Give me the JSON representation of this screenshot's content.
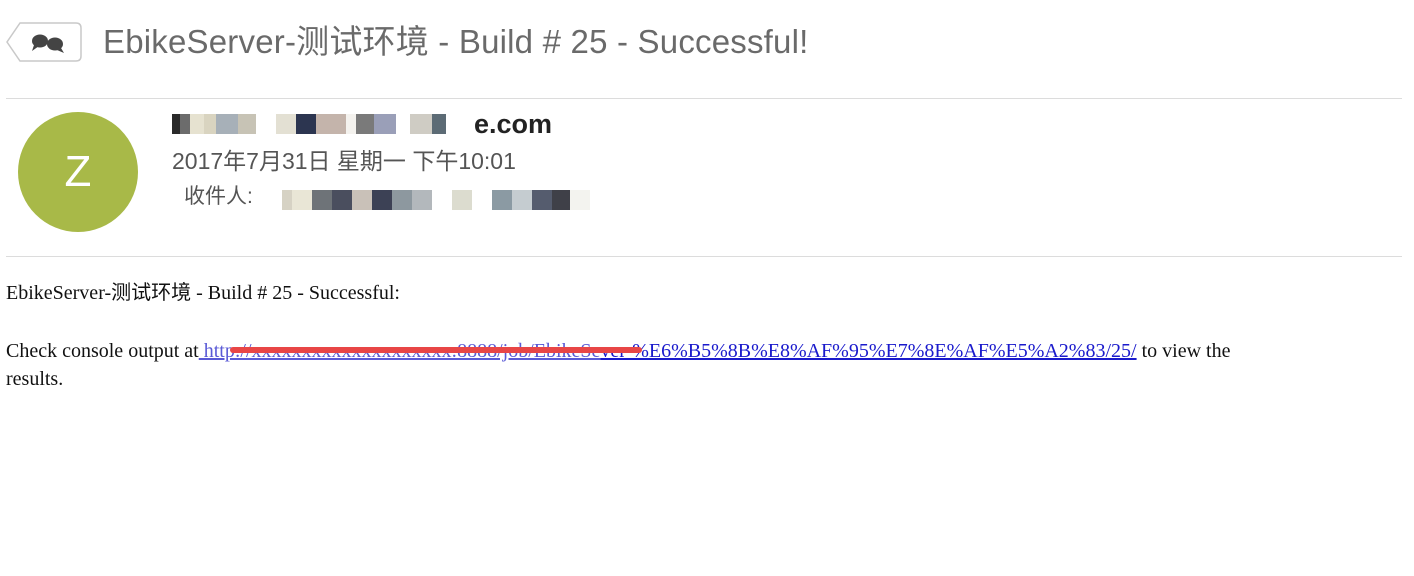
{
  "header": {
    "subject": "EbikeServer-测试环境 - Build # 25 - Successful!",
    "conversation_icon": "speech-bubbles-icon"
  },
  "sender": {
    "avatar_letter": "Z",
    "avatar_color": "#a8b948",
    "email_visible_suffix": "e.com",
    "date": "2017年7月31日 星期一 下午10:01",
    "recipient_label": "收件人:"
  },
  "message": {
    "line1": "EbikeServer-测试环境 - Build # 25 - Successful:",
    "line2_prefix": "Check console output at",
    "link_visible": "ver-%E6%B5%8B%E8%AF%95%E7%8E%AF%E5%A2%83/25/",
    "line2_suffix": " to view the",
    "line3": "results."
  },
  "colors": {
    "link": "#1a1acc",
    "redaction_line": "#e84646"
  }
}
